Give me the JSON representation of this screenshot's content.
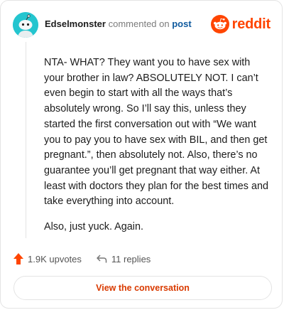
{
  "comment": {
    "username": "Edselmonster",
    "action": "commented on",
    "post_link": "post",
    "paragraphs": [
      "NTA- WHAT? They want you to have sex with your brother in law? ABSOLUTELY NOT. I can’t even begin to start with all the ways that’s absolutely wrong. So I’ll say this, unless they started the first conversation out with “We want you to pay you to have sex with BIL, and then get pregnant.”, then absolutely not. Also, there’s no guarantee you’ll get pregnant that way either. At least with doctors they plan for the best times and take everything into account.",
      "Also, just yuck. Again."
    ]
  },
  "brand": {
    "word": "reddit",
    "icon": "reddit-snoo-icon",
    "color": "#ff4500"
  },
  "avatar": {
    "icon": "snoo-avatar-icon",
    "color": "#24c5cf"
  },
  "stats": {
    "upvotes_label": "1.9K upvotes",
    "upvote_icon": "upvote-arrow-icon",
    "replies_label": "11 replies",
    "reply_icon": "reply-arrow-icon"
  },
  "cta": {
    "label": "View the conversation",
    "color": "#d93a00"
  }
}
